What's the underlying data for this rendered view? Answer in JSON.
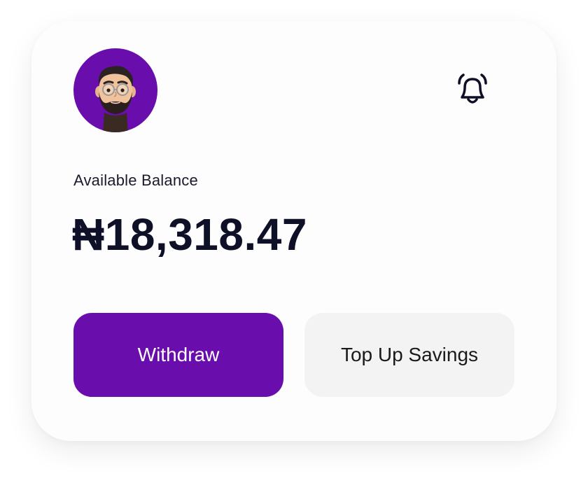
{
  "header": {
    "avatar_icon": "memoji-avatar",
    "notification_icon": "bell-icon",
    "accent_color": "#6a0dad"
  },
  "balance": {
    "label": "Available Balance",
    "amount": "₦18,318.47"
  },
  "actions": {
    "withdraw_label": "Withdraw",
    "topup_label": "Top Up Savings"
  }
}
